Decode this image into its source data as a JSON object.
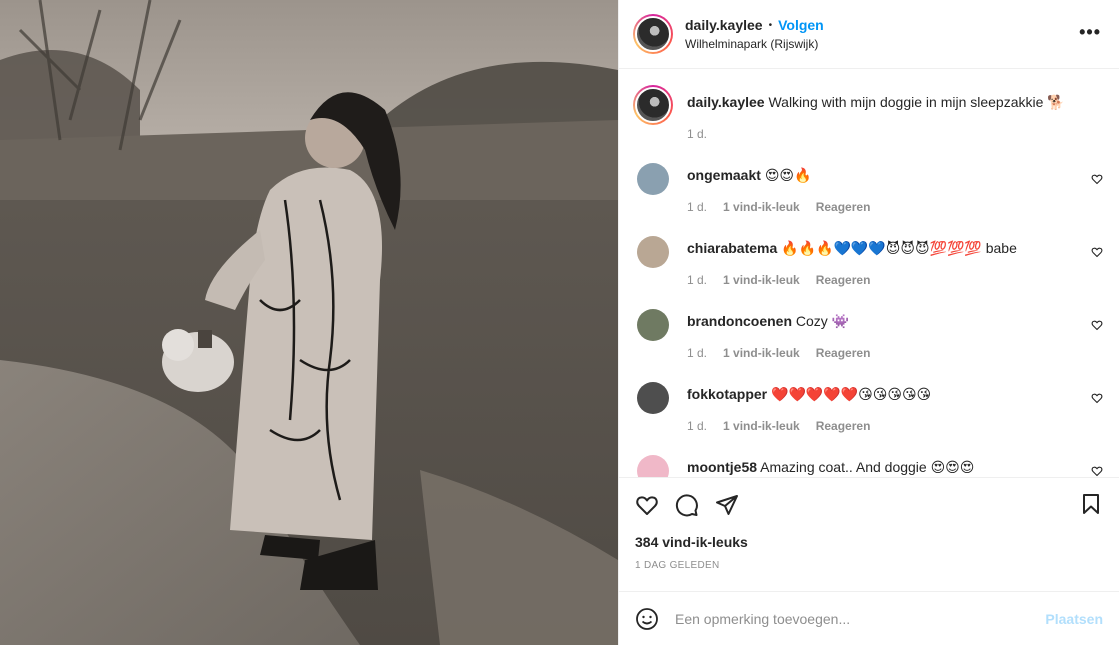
{
  "post": {
    "author": "daily.kaylee",
    "follow_label": "Volgen",
    "location": "Wilhelminapark (Rijswijk)",
    "more_label": "•••",
    "caption_text": "Walking with mijn doggie in mijn sleepzakkie 🐕",
    "caption_time": "1 d.",
    "likes": "384 vind-ik-leuks",
    "time_ago": "1 DAG GELEDEN"
  },
  "comments": [
    {
      "user": "ongemaakt",
      "text": "😍😍🔥",
      "time": "1 d.",
      "likes": "1 vind-ik-leuk",
      "reply": "Reageren",
      "avatar_color": "#8aa0b0"
    },
    {
      "user": "chiarabatema",
      "text": "🔥🔥🔥💙💙💙😈😈😈💯💯💯 babe",
      "time": "1 d.",
      "likes": "1 vind-ik-leuk",
      "reply": "Reageren",
      "avatar_color": "#b9a794"
    },
    {
      "user": "brandoncoenen",
      "text": "Cozy 👾",
      "time": "1 d.",
      "likes": "1 vind-ik-leuk",
      "reply": "Reageren",
      "avatar_color": "#6f7a62"
    },
    {
      "user": "fokkotapper",
      "text": "❤️❤️❤️❤️❤️😘😘😘😘😘",
      "time": "1 d.",
      "likes": "1 vind-ik-leuk",
      "reply": "Reageren",
      "avatar_color": "#4e4e4e"
    },
    {
      "user": "moontje58",
      "text": "Amazing coat.. And doggie 😍😍😍",
      "time": "",
      "likes": "",
      "reply": "",
      "avatar_color": "#f0b8c8"
    }
  ],
  "add_comment": {
    "placeholder": "Een opmerking toevoegen...",
    "post_label": "Plaatsen"
  },
  "icons": {
    "like": "heart-icon",
    "comment": "comment-icon",
    "share": "send-icon",
    "save": "bookmark-icon",
    "emoji": "emoji-icon",
    "comment_like": "heart-small-icon"
  },
  "colors": {
    "follow": "#0095f6",
    "post_button_disabled": "#b2dffc",
    "muted": "#8e8e8e"
  }
}
